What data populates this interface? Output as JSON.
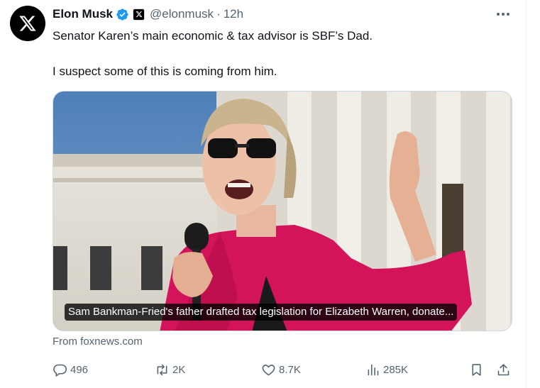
{
  "author": {
    "name": "Elon Musk",
    "handle": "@elonmusk",
    "separator": "·",
    "time": "12h",
    "avatar_icon": "x-logo-icon",
    "verified_color": "#1d9bf0"
  },
  "tweet": {
    "line1": "Senator Karen’s main economic & tax advisor is SBF’s Dad.",
    "line2": "I suspect some of this is coming from him."
  },
  "card": {
    "caption": "Sam Bankman-Fried's father drafted tax legislation for Elizabeth Warren, donate...",
    "source": "From foxnews.com"
  },
  "actions": {
    "replies": "496",
    "reposts": "2K",
    "likes": "8.7K",
    "views": "285K"
  },
  "colors": {
    "text_primary": "#0f1419",
    "text_secondary": "#536471",
    "border": "#cfd9de"
  }
}
